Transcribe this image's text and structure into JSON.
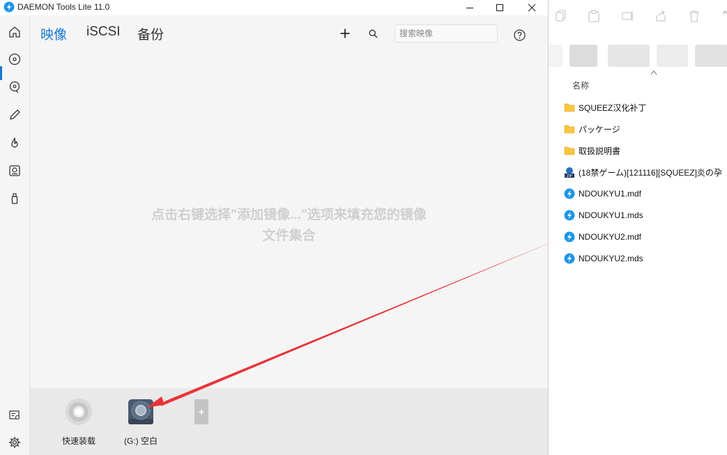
{
  "window": {
    "title": "DAEMON Tools Lite 11.0",
    "minimize_icon": "minimize-icon",
    "maximize_icon": "maximize-icon",
    "close_icon": "close-icon"
  },
  "sidebar": {
    "items": [
      {
        "name": "home",
        "icon": "home-icon"
      },
      {
        "name": "images",
        "icon": "disc-icon",
        "active": true
      },
      {
        "name": "disc-search",
        "icon": "disc-search-icon"
      },
      {
        "name": "editor",
        "icon": "pencil-icon"
      },
      {
        "name": "burn",
        "icon": "flame-icon"
      },
      {
        "name": "virtual-hdd",
        "icon": "hdd-icon"
      },
      {
        "name": "usb",
        "icon": "usb-icon"
      }
    ],
    "bottom": [
      {
        "name": "license",
        "icon": "license-icon"
      },
      {
        "name": "settings",
        "icon": "gear-icon"
      }
    ]
  },
  "tabs": [
    {
      "label": "映像",
      "active": true
    },
    {
      "label": "iSCSI",
      "active": false
    },
    {
      "label": "备份",
      "active": false
    }
  ],
  "toolbar": {
    "add_icon": "plus-icon",
    "search_icon": "search-icon",
    "search_placeholder": "搜索映像",
    "help_icon": "help-icon"
  },
  "main": {
    "empty_line1": "点击右键选择\"添加镜像...\"选项来填充您的镜像",
    "empty_line2": "文件集合"
  },
  "tray": {
    "devices": [
      {
        "label": "快速装载",
        "icon": "quick-mount-icon"
      },
      {
        "label": "(G:) 空白",
        "icon": "virtual-drive-icon"
      }
    ],
    "add_drive_label": "+"
  },
  "explorer": {
    "column_header": "名称",
    "files": [
      {
        "name": "SQUEEZ汉化补丁",
        "type": "folder"
      },
      {
        "name": "パッケージ",
        "type": "folder"
      },
      {
        "name": "取扱説明書",
        "type": "folder"
      },
      {
        "name": "(18禁ゲーム)[121116][SQUEEZ]炎の孕",
        "type": "zip"
      },
      {
        "name": "NDOUKYU1.mdf",
        "type": "daemon"
      },
      {
        "name": "NDOUKYU1.mds",
        "type": "daemon"
      },
      {
        "name": "NDOUKYU2.mdf",
        "type": "daemon"
      },
      {
        "name": "NDOUKYU2.mds",
        "type": "daemon"
      }
    ]
  },
  "colors": {
    "accent": "#1778d4",
    "annotation_arrow": "#e8333a"
  }
}
